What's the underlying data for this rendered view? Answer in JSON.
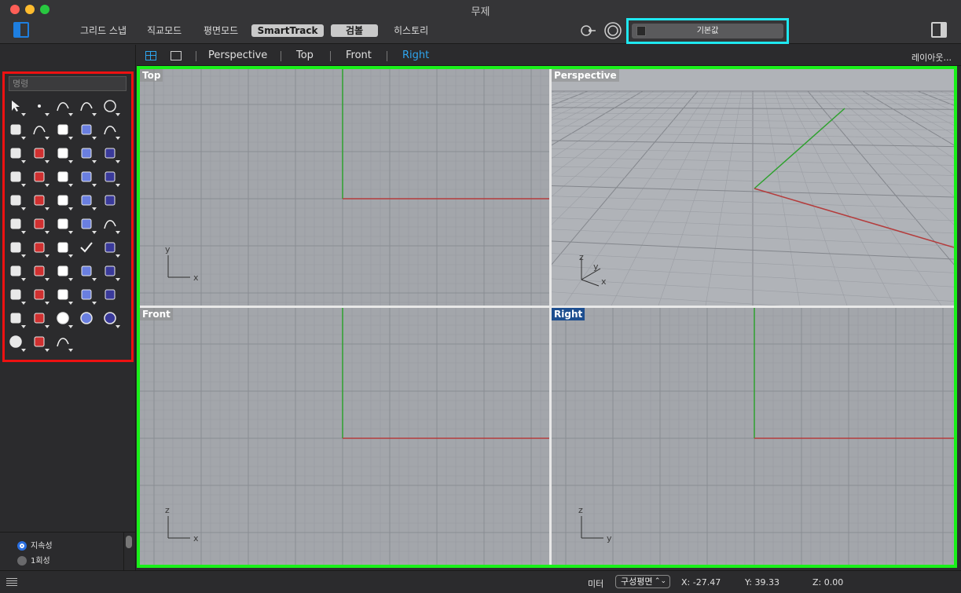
{
  "window": {
    "title": "무제",
    "traffic_lights": [
      {
        "name": "close",
        "color": "#ff5f57"
      },
      {
        "name": "minimize",
        "color": "#febc2e"
      },
      {
        "name": "zoom",
        "color": "#28c840"
      }
    ]
  },
  "toolbar": {
    "buttons": [
      {
        "label": "그리드 스냅",
        "active": false
      },
      {
        "label": "직교모드",
        "active": false
      },
      {
        "label": "평면모드",
        "active": false
      },
      {
        "label": "SmartTrack",
        "active": true
      },
      {
        "label": "검볼",
        "active": true
      },
      {
        "label": "히스토리",
        "active": false
      }
    ],
    "layer": {
      "current": "기본값"
    }
  },
  "command_panel": {
    "placeholder": "명령",
    "tools": [
      "select-arrow-icon",
      "point-icon",
      "polyline-icon",
      "curve-icon",
      "circle-icon",
      "ellipse-icon",
      "arc-icon",
      "rectangle-icon",
      "polygon-icon",
      "fillet-curve-icon",
      "surface-from-points-icon",
      "revolve-surface-icon",
      "box-icon",
      "boolean-union-icon",
      "cylinder-icon",
      "surface-patch-icon",
      "explode-icon",
      "split-icon",
      "trim-icon",
      "extend-icon",
      "group-icon",
      "points-cloud-icon",
      "fillet-edge-icon",
      "offset-icon",
      "text-icon",
      "move-icon",
      "array-icon",
      "mirror-icon",
      "bounding-box-icon",
      "dimension-icon",
      "grid-icon",
      "layer-icon",
      "properties-icon",
      "check-icon",
      "cage-edit-icon",
      "gumball-icon",
      "zoom-icon",
      "zoom-window-icon",
      "zoom-extents-icon",
      "zoom-selected-icon",
      "rotate-view-icon",
      "car-icon",
      "plane-icon",
      "named-position-icon",
      "light-icon",
      "lock-icon",
      "layer-stack-icon",
      "color-wheel-icon",
      "sphere-white-icon",
      "ground-plane-icon",
      "sphere-blue-icon",
      "spotlight-icon",
      "dimension-tool-icon"
    ],
    "options": [
      {
        "label": "지속성",
        "selected": true
      },
      {
        "label": "1회성",
        "selected": false
      }
    ]
  },
  "viewport_tabs": {
    "tabs": [
      {
        "label": "Perspective",
        "active": false
      },
      {
        "label": "Top",
        "active": false
      },
      {
        "label": "Front",
        "active": false
      },
      {
        "label": "Right",
        "active": true
      }
    ],
    "layout_button": "레이아웃..."
  },
  "viewports": [
    {
      "name": "Top",
      "axes": [
        "x",
        "y"
      ],
      "active": false
    },
    {
      "name": "Perspective",
      "axes": [
        "x",
        "y",
        "z"
      ],
      "active": false
    },
    {
      "name": "Front",
      "axes": [
        "x",
        "z"
      ],
      "active": false
    },
    {
      "name": "Right",
      "axes": [
        "y",
        "z"
      ],
      "active": true
    }
  ],
  "colors": {
    "x_axis": "#b43c3c",
    "y_axis": "#2ea12e",
    "layer_highlight": "#1fe8f0",
    "command_highlight": "#ee1111",
    "viewport_highlight": "#19f019",
    "accent": "#2ea6f0"
  },
  "status": {
    "units": "미터",
    "cplane": "구성평면",
    "x": "X: -27.47",
    "y": "Y: 39.33",
    "z": "Z: 0.00"
  }
}
